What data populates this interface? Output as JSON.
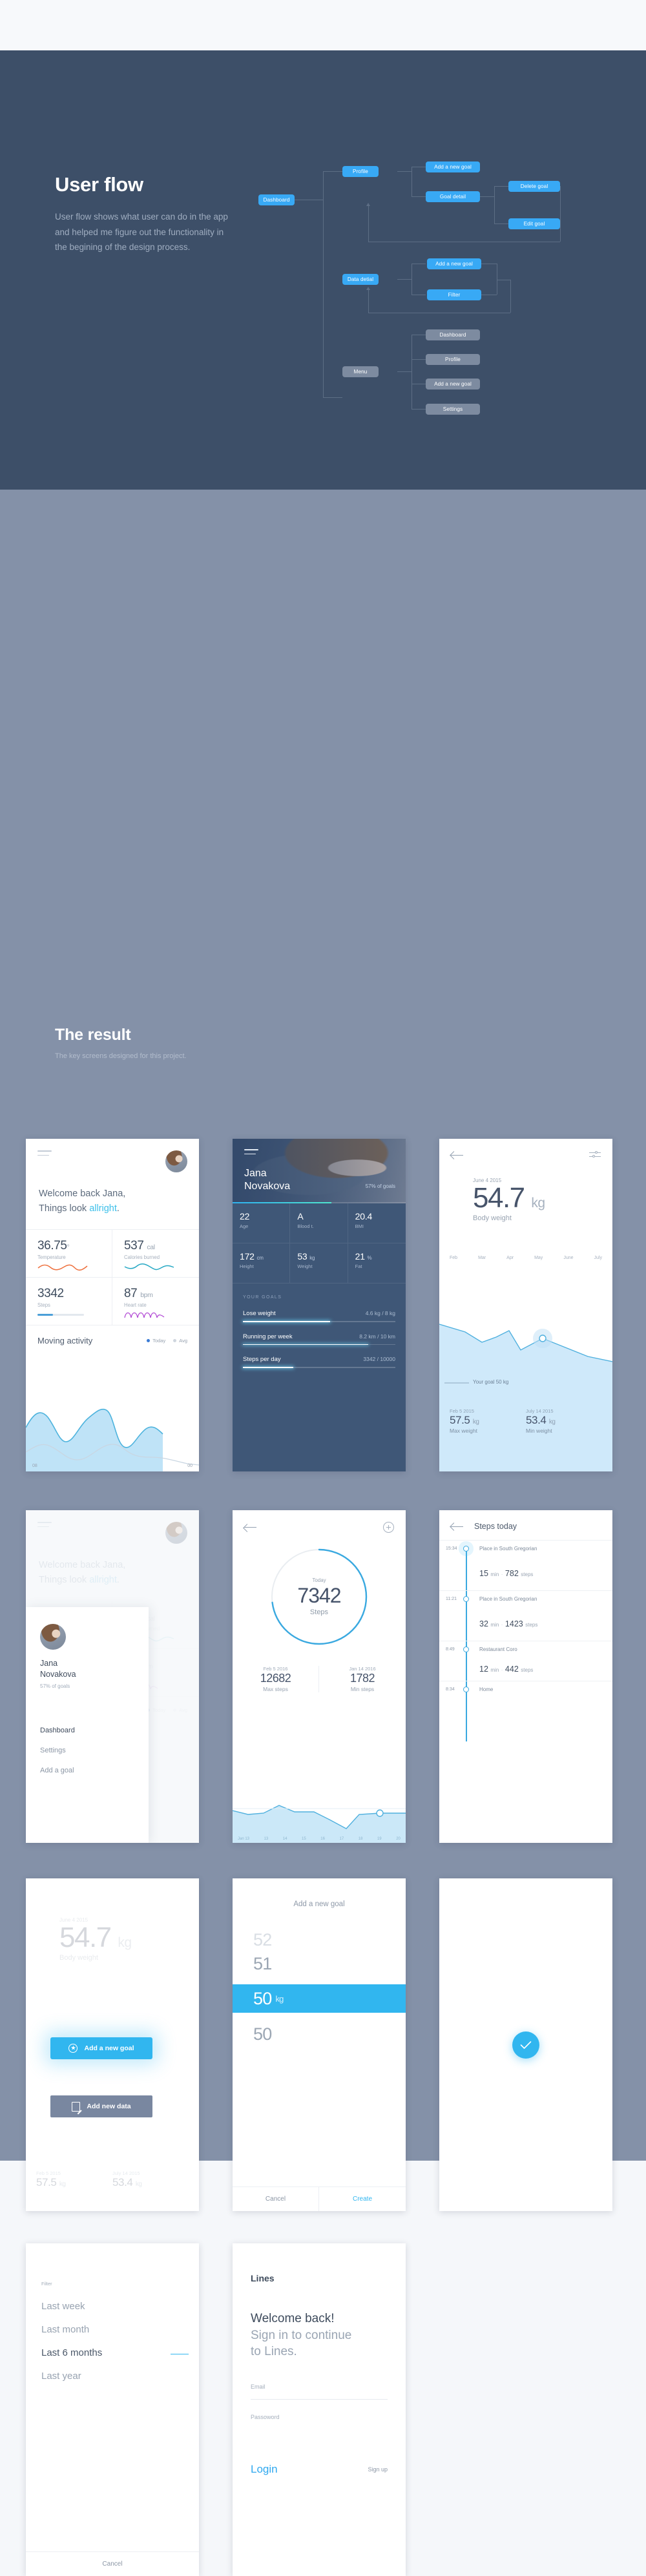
{
  "userflow": {
    "title": "User flow",
    "description": "User flow shows what user can do in the app and helped me figure out the functionality in the begining of the design process.",
    "nodes": {
      "dashboard": "Dashboard",
      "profile": "Profile",
      "add_goal_1": "Add a new goal",
      "goal_detail": "Goal detail",
      "delete_goal": "Delete goal",
      "edit_goal": "Edit goal",
      "data_detail": "Data detial",
      "add_goal_2": "Add a new goal",
      "filter": "Filter",
      "menu": "Menu",
      "menu_dashboard": "Dashboard",
      "menu_profile": "Profile",
      "menu_add_goal": "Add a new goal",
      "menu_settings": "Settings"
    },
    "colors": {
      "background": "#3d4f68",
      "node_blue": "#38a9f5",
      "node_grey": "#7d8ba0",
      "line": "#5d6e85"
    }
  },
  "result": {
    "title": "The result",
    "subtitle": "The key screens designed for this project.",
    "background": "#8491a8"
  },
  "screens": {
    "dashboard": {
      "greeting_line1": "Welcome back Jana,",
      "greeting_line2_pre": "Things look ",
      "greeting_accent": "allright",
      "greeting_period": ".",
      "stats": [
        {
          "value": "36.75",
          "unit": "°",
          "label": "Temperature",
          "viz": "sparkline",
          "color": "#ee6f3c"
        },
        {
          "value": "537",
          "unit": "cal",
          "label": "Calories burned",
          "viz": "sparkline",
          "color": "#25a8c4"
        },
        {
          "value": "3342",
          "unit": "",
          "label": "Steps",
          "viz": "bar",
          "color": "#4b9fd8"
        },
        {
          "value": "87",
          "unit": "bpm",
          "label": "Heart rate",
          "viz": "pulse",
          "color": "#b44fd6"
        }
      ],
      "chart_title": "Moving activity",
      "legend": [
        {
          "label": "Today",
          "color": "#3a7bd5"
        },
        {
          "label": "Avg",
          "color": "#cfd6de"
        }
      ],
      "axis_left": "08",
      "axis_right": "00"
    },
    "profile": {
      "name_line1": "Jana",
      "name_line2": "Novakova",
      "goal_pct_text": "57% of goals",
      "progress_pct": 57,
      "metrics": [
        {
          "value": "22",
          "unit": "",
          "label": "Age"
        },
        {
          "value": "A",
          "unit": "",
          "label": "Blood t."
        },
        {
          "value": "20.4",
          "unit": "",
          "label": "BMI"
        },
        {
          "value": "172",
          "unit": "cm",
          "label": "Height"
        },
        {
          "value": "53",
          "unit": "kg",
          "label": "Weight"
        },
        {
          "value": "21",
          "unit": "%",
          "label": "Fat"
        }
      ],
      "goals_header": "YOUR GOALS",
      "goals": [
        {
          "name": "Lose weight",
          "amount": "4.6 kg / 8 kg",
          "pct": 57
        },
        {
          "name": "Running per week",
          "amount": "8.2 km / 10 km",
          "pct": 82
        },
        {
          "name": "Steps per day",
          "amount": "3342 / 10000",
          "pct": 33
        }
      ]
    },
    "bodyweight": {
      "date": "June 4 2015",
      "value": "54.7",
      "unit": "kg",
      "label": "Body weight",
      "months": [
        "Feb",
        "Mar",
        "Apr",
        "May",
        "June",
        "July"
      ],
      "goal_note": "Your goal 50 kg",
      "max": {
        "date": "Feb 5 2015",
        "value": "57.5",
        "unit": "kg",
        "label": "Max weight"
      },
      "min": {
        "date": "July 14 2015",
        "value": "53.4",
        "unit": "kg",
        "label": "Min weight"
      }
    },
    "menu": {
      "name_line1": "Jana",
      "name_line2": "Novakova",
      "goal_pct_text": "57% of goals",
      "items": [
        "Dashboard",
        "Settings",
        "Add a goal"
      ],
      "active_item": "Dashboard"
    },
    "steps": {
      "ring_label": "Today",
      "ring_value": "7342",
      "ring_unit": "Steps",
      "ring_pct": 73,
      "max": {
        "date": "Feb 5 2016",
        "value": "12682",
        "label": "Max steps"
      },
      "min": {
        "date": "Jan 14 2016",
        "value": "1782",
        "label": "Min steps"
      },
      "axis": [
        "Jan 13",
        "13",
        "14",
        "15",
        "16",
        "17",
        "18",
        "19",
        "20"
      ]
    },
    "steps_today": {
      "title": "Steps today",
      "entries": [
        {
          "time": "15:34",
          "place": "Place in South Gregorian",
          "minutes": "15",
          "min_unit": "min",
          "steps": "782",
          "steps_unit": "steps",
          "highlight": true
        },
        {
          "time": "11:21",
          "place": "Place in South Gregorian",
          "minutes": "32",
          "min_unit": "min",
          "steps": "1423",
          "steps_unit": "steps",
          "highlight": false
        },
        {
          "time": "8:49",
          "place": "Restaurant Coro",
          "minutes": "12",
          "min_unit": "min",
          "steps": "442",
          "steps_unit": "steps",
          "highlight": false
        }
      ],
      "last_time": "8:34",
      "last_place": "Home"
    },
    "actions": {
      "bg_date": "June 4 2015",
      "bg_value": "54.7",
      "bg_unit": "kg",
      "bg_label": "Body weight",
      "primary": "Add a new goal",
      "secondary": "Add new data",
      "bg_max": {
        "date": "Feb 5 2015",
        "value": "57.5",
        "unit": "kg",
        "label": "Max weight"
      },
      "bg_min": {
        "date": "July 14 2015",
        "value": "53.4",
        "unit": "kg",
        "label": "Min weight"
      }
    },
    "picker": {
      "title": "Add a new goal",
      "above2": "52",
      "above1": "51",
      "selected": "50",
      "selected_unit": "kg",
      "below1": "50",
      "cancel": "Cancel",
      "create": "Create"
    },
    "success": {
      "icon": "check-icon",
      "color": "#31b6ef"
    },
    "filter": {
      "label": "Filter",
      "options": [
        "Last week",
        "Last month",
        "Last 6 months",
        "Last year"
      ],
      "selected": "Last 6 months",
      "cancel": "Cancel"
    },
    "login": {
      "brand": "Lines",
      "head_line1": "Welcome back!",
      "head_line2": "Sign in to continue",
      "head_line3": "to Lines.",
      "email_label": "Email",
      "password_label": "Passoword",
      "login": "Login",
      "signup": "Sign up"
    }
  }
}
